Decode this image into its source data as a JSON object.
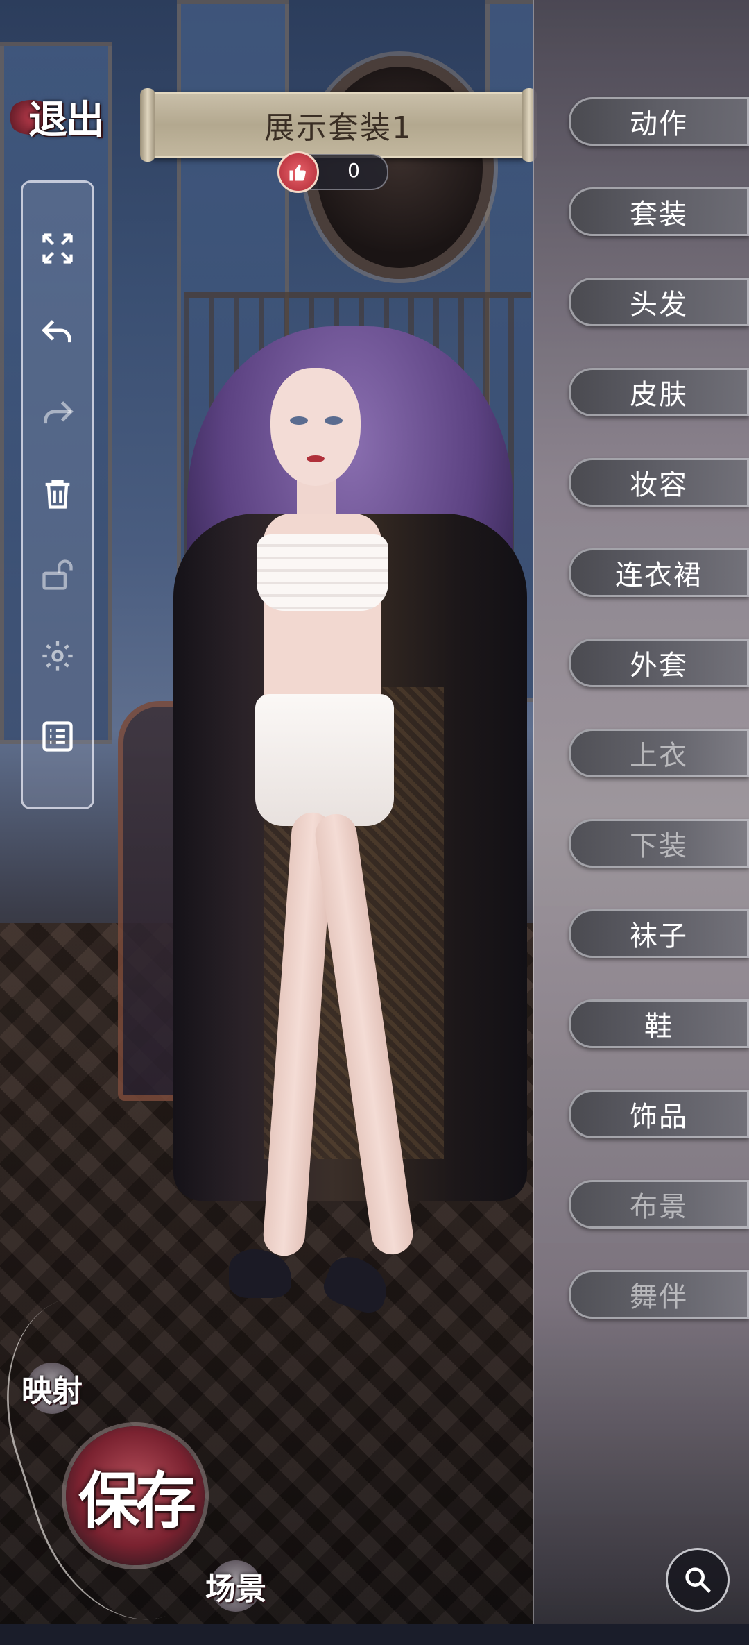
{
  "top": {
    "exit_label": "退出",
    "outfit_title": "展示套装1",
    "like_count": "0"
  },
  "toolbar": {
    "items": [
      {
        "icon": "fullscreen-icon"
      },
      {
        "icon": "undo-icon"
      },
      {
        "icon": "redo-icon"
      },
      {
        "icon": "trash-icon"
      },
      {
        "icon": "unlock-icon"
      },
      {
        "icon": "gear-icon"
      },
      {
        "icon": "list-icon"
      }
    ]
  },
  "categories": [
    {
      "label": "动作",
      "enabled": true
    },
    {
      "label": "套装",
      "enabled": true
    },
    {
      "label": "头发",
      "enabled": true
    },
    {
      "label": "皮肤",
      "enabled": true
    },
    {
      "label": "妆容",
      "enabled": true
    },
    {
      "label": "连衣裙",
      "enabled": true
    },
    {
      "label": "外套",
      "enabled": true
    },
    {
      "label": "上衣",
      "enabled": false
    },
    {
      "label": "下装",
      "enabled": false
    },
    {
      "label": "袜子",
      "enabled": true
    },
    {
      "label": "鞋",
      "enabled": true
    },
    {
      "label": "饰品",
      "enabled": true
    },
    {
      "label": "布景",
      "enabled": false
    },
    {
      "label": "舞伴",
      "enabled": false
    }
  ],
  "actions": {
    "map_label": "映射",
    "save_label": "保存",
    "scene_label": "场景"
  },
  "search_icon": "search-icon"
}
